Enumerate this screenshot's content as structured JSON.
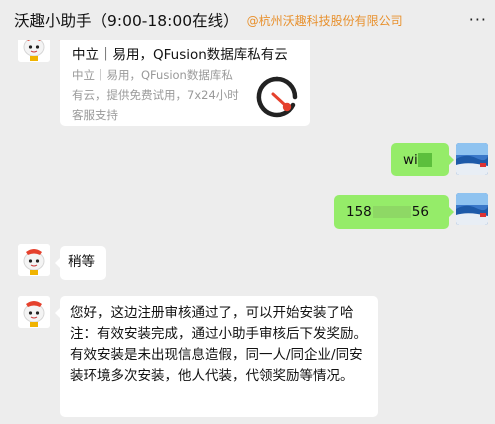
{
  "header": {
    "title": "沃趣小助手（9:00-18:00在线）",
    "company": "@杭州沃趣科技股份有限公司",
    "more_icon": "more-dots-icon",
    "more_label": "···"
  },
  "messages": {
    "card": {
      "title": "中立｜易用，QFusion数据库私有云",
      "description": "中立｜易用，QFusion数据库私有云，提供免费试用，7x24小时客服支持",
      "icon": "qfusion-logo-icon"
    },
    "user_msg1": {
      "text": "wi"
    },
    "user_msg2": {
      "prefix": "158",
      "suffix": "56"
    },
    "bot_msg1": {
      "text": "稍等"
    },
    "bot_msg2": {
      "text": "您好，这边注册审核通过了，可以开始安装了哈注：有效安装完成，通过小助手审核后下发奖励。有效安装是未出现信息造假，同一人/同企业/同安装环境多次安装，他人代装，代领奖励等情况。"
    }
  },
  "colors": {
    "background": "#ededed",
    "bubble_self": "#95ec69",
    "bubble_other": "#ffffff",
    "company_tag": "#e8912e",
    "logo_red": "#e5412d"
  }
}
